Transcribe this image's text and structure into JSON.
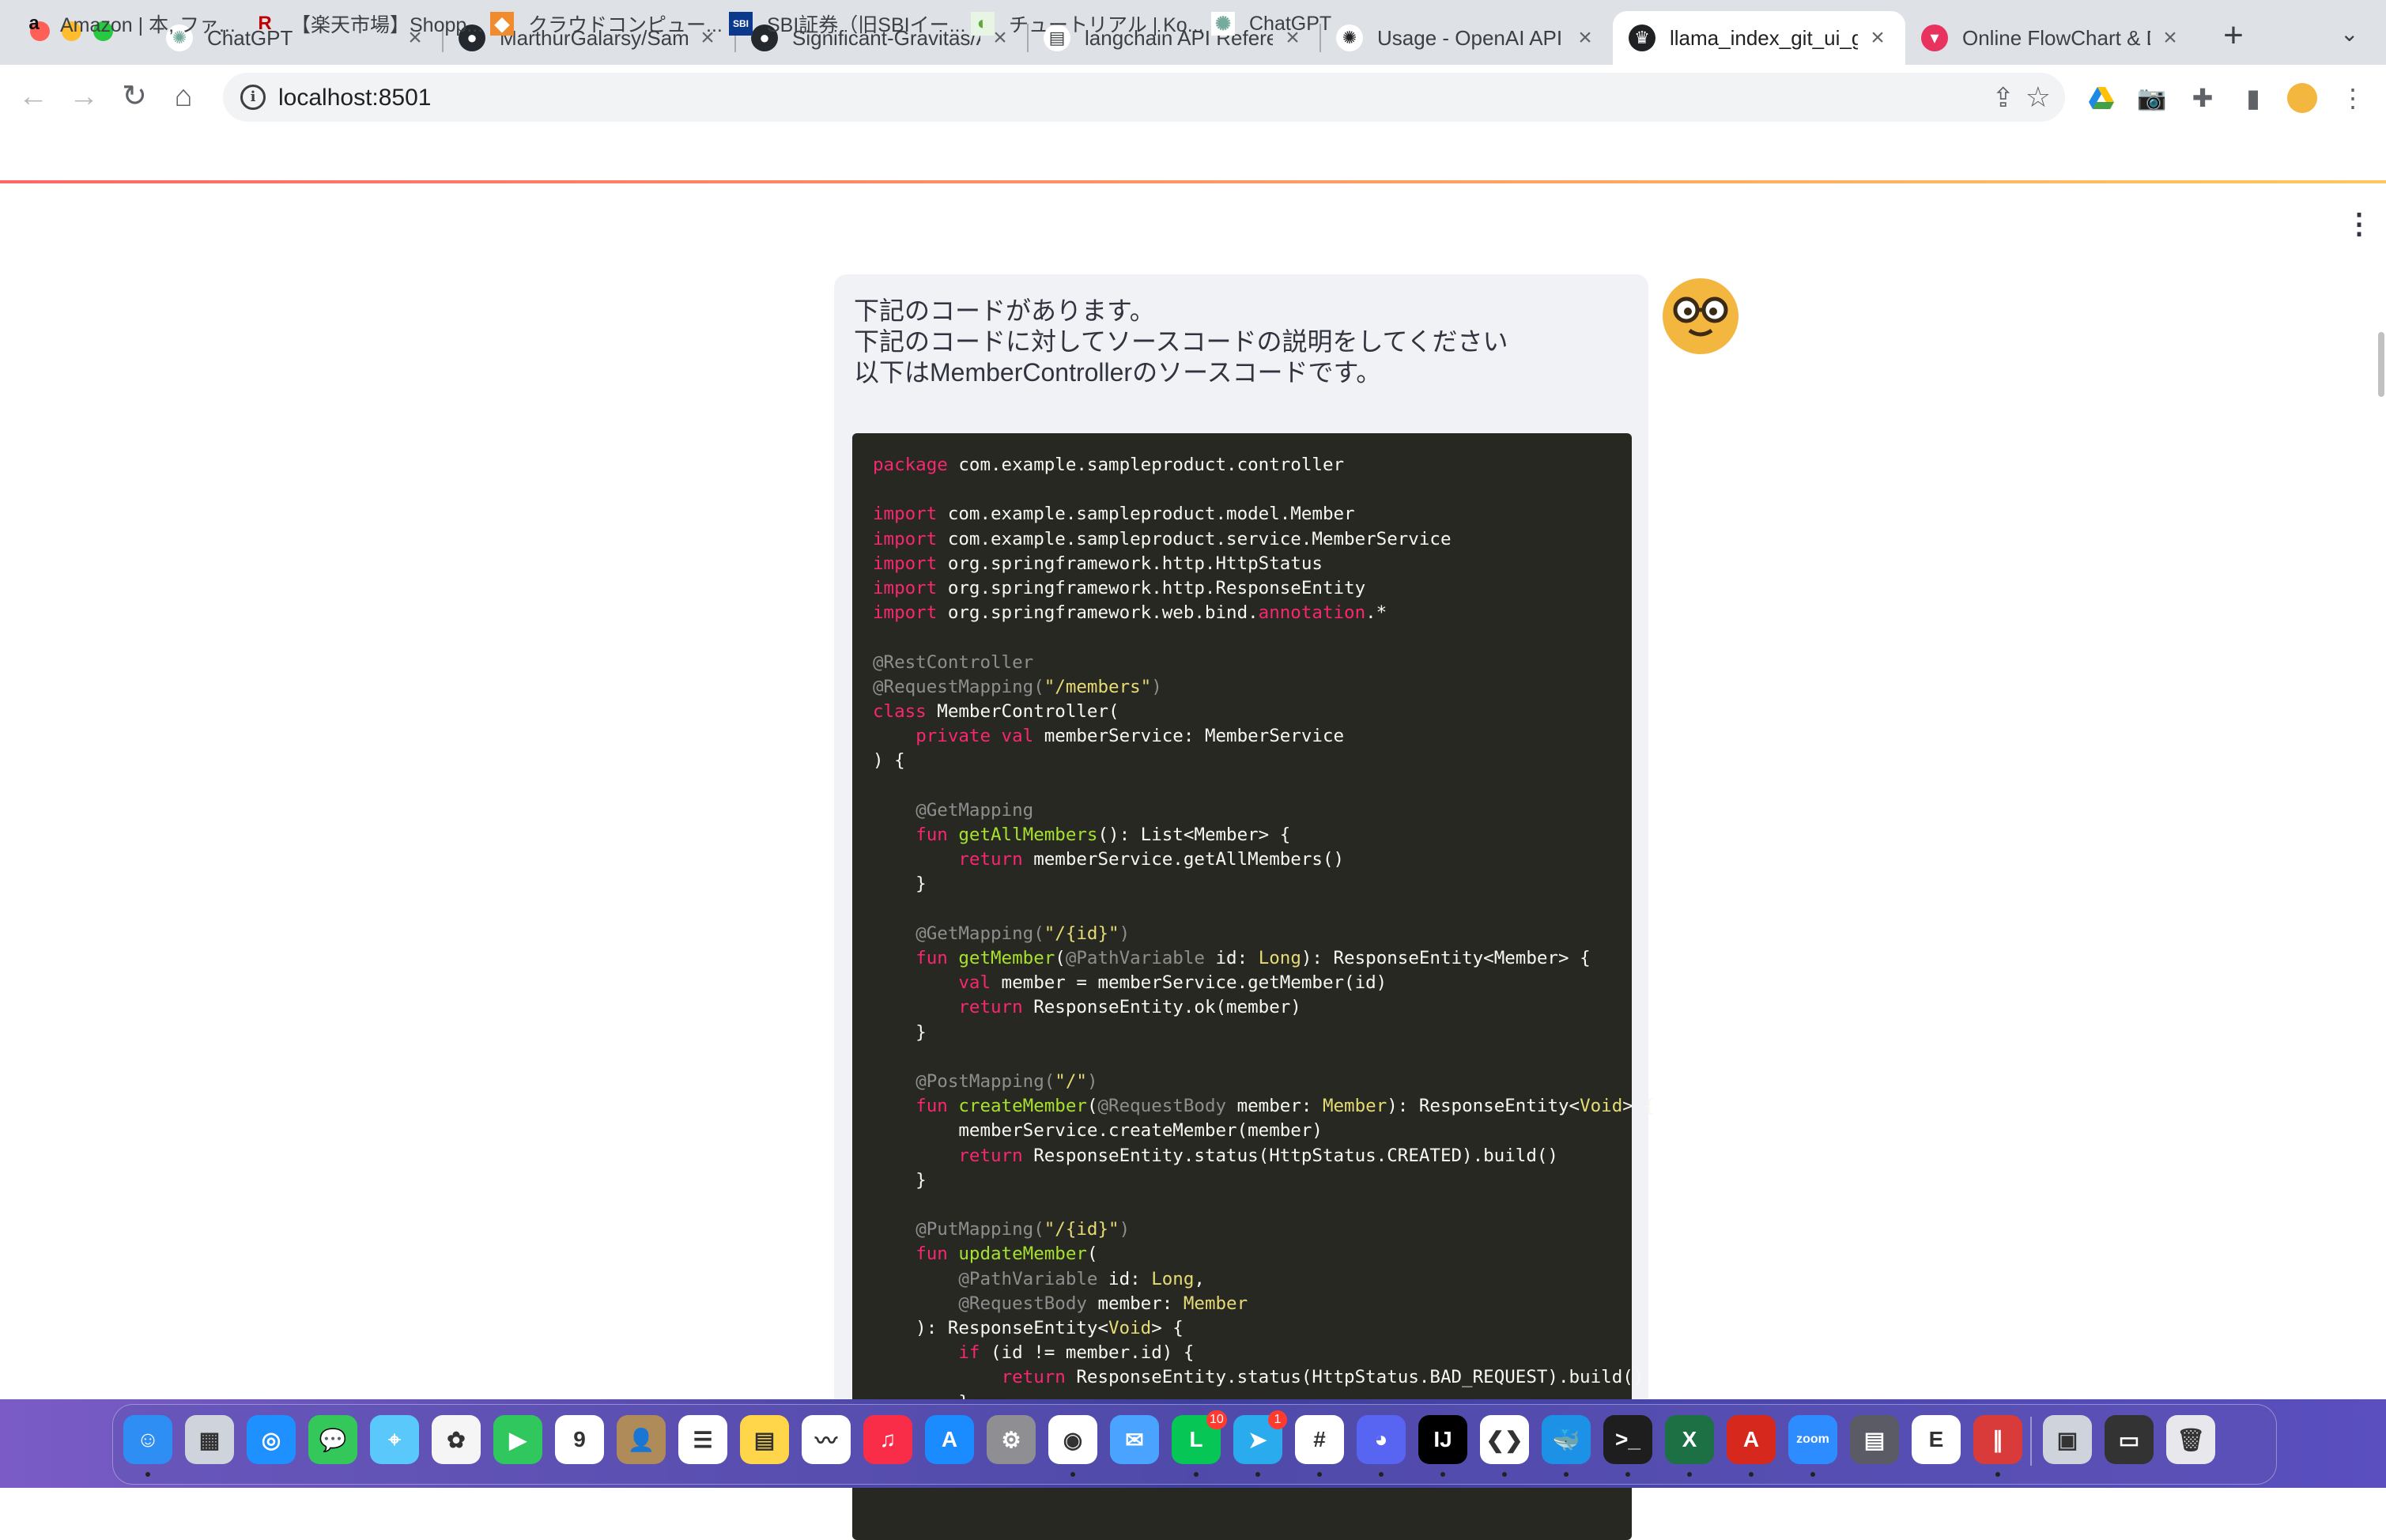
{
  "browser": {
    "tabs": [
      {
        "title": "ChatGPT",
        "icon": "chatgpt-icon",
        "active": false
      },
      {
        "title": "MarthurGalarsy/Samp",
        "icon": "github-icon",
        "active": false
      },
      {
        "title": "Significant-Gravitas/A",
        "icon": "github-icon",
        "active": false
      },
      {
        "title": "langchain API Referen",
        "icon": "document-icon",
        "active": false
      },
      {
        "title": "Usage - OpenAI API",
        "icon": "openai-icon",
        "active": false
      },
      {
        "title": "llama_index_git_ui_g",
        "icon": "streamlit-icon",
        "active": true
      },
      {
        "title": "Online FlowChart & D",
        "icon": "flowchart-icon",
        "active": false
      }
    ],
    "new_tab": "+",
    "tab_close": "×",
    "url": "localhost:8501",
    "bookmarks": [
      {
        "label": "Amazon | 本, ファ...",
        "icon": "amazon-icon"
      },
      {
        "label": "【楽天市場】Shopp...",
        "icon": "rakuten-icon"
      },
      {
        "label": "クラウドコンピュー...",
        "icon": "aws-icon"
      },
      {
        "label": "SBI証券（旧SBIイー...",
        "icon": "sbi-icon"
      },
      {
        "label": "チュートリアル | Ko...",
        "icon": "kotlin-icon"
      },
      {
        "label": "ChatGPT",
        "icon": "chatgpt-icon"
      }
    ]
  },
  "chat": {
    "message_lines": [
      "下記のコードがあります。",
      "下記のコードに対してソースコードの説明をしてください",
      "以下はMemberControllerのソースコードです。"
    ],
    "code_lines": [
      [
        {
          "c": "k",
          "t": "package"
        },
        {
          "c": "",
          "t": " com.example.sampleproduct.controller"
        }
      ],
      [],
      [
        {
          "c": "k",
          "t": "import"
        },
        {
          "c": "",
          "t": " com.example.sampleproduct.model.Member"
        }
      ],
      [
        {
          "c": "k",
          "t": "import"
        },
        {
          "c": "",
          "t": " com.example.sampleproduct.service.MemberService"
        }
      ],
      [
        {
          "c": "k",
          "t": "import"
        },
        {
          "c": "",
          "t": " org.springframework.http.HttpStatus"
        }
      ],
      [
        {
          "c": "k",
          "t": "import"
        },
        {
          "c": "",
          "t": " org.springframework.http.ResponseEntity"
        }
      ],
      [
        {
          "c": "k",
          "t": "import"
        },
        {
          "c": "",
          "t": " org.springframework.web.bind."
        },
        {
          "c": "k",
          "t": "annotation"
        },
        {
          "c": "",
          "t": ".*"
        }
      ],
      [],
      [
        {
          "c": "a",
          "t": "@RestController"
        }
      ],
      [
        {
          "c": "a",
          "t": "@RequestMapping("
        },
        {
          "c": "s",
          "t": "\"/members\""
        },
        {
          "c": "a",
          "t": ")"
        }
      ],
      [
        {
          "c": "k",
          "t": "class"
        },
        {
          "c": "",
          "t": " MemberController("
        }
      ],
      [
        {
          "c": "",
          "t": "    "
        },
        {
          "c": "k",
          "t": "private val"
        },
        {
          "c": "",
          "t": " memberService: MemberService"
        }
      ],
      [
        {
          "c": "",
          "t": ") {"
        }
      ],
      [],
      [
        {
          "c": "",
          "t": "    "
        },
        {
          "c": "a",
          "t": "@GetMapping"
        }
      ],
      [
        {
          "c": "",
          "t": "    "
        },
        {
          "c": "k",
          "t": "fun"
        },
        {
          "c": "",
          "t": " "
        },
        {
          "c": "f",
          "t": "getAllMembers"
        },
        {
          "c": "",
          "t": "(): List<Member> {"
        }
      ],
      [
        {
          "c": "",
          "t": "        "
        },
        {
          "c": "k",
          "t": "return"
        },
        {
          "c": "",
          "t": " memberService.getAllMembers()"
        }
      ],
      [
        {
          "c": "",
          "t": "    }"
        }
      ],
      [],
      [
        {
          "c": "",
          "t": "    "
        },
        {
          "c": "a",
          "t": "@GetMapping("
        },
        {
          "c": "s",
          "t": "\"/{id}\""
        },
        {
          "c": "a",
          "t": ")"
        }
      ],
      [
        {
          "c": "",
          "t": "    "
        },
        {
          "c": "k",
          "t": "fun"
        },
        {
          "c": "",
          "t": " "
        },
        {
          "c": "f",
          "t": "getMember"
        },
        {
          "c": "",
          "t": "("
        },
        {
          "c": "a",
          "t": "@PathVariable"
        },
        {
          "c": "",
          "t": " id: "
        },
        {
          "c": "t",
          "t": "Long"
        },
        {
          "c": "",
          "t": "): ResponseEntity<Member> {"
        }
      ],
      [
        {
          "c": "",
          "t": "        "
        },
        {
          "c": "k",
          "t": "val"
        },
        {
          "c": "",
          "t": " member = memberService.getMember(id)"
        }
      ],
      [
        {
          "c": "",
          "t": "        "
        },
        {
          "c": "k",
          "t": "return"
        },
        {
          "c": "",
          "t": " ResponseEntity.ok(member)"
        }
      ],
      [
        {
          "c": "",
          "t": "    }"
        }
      ],
      [],
      [
        {
          "c": "",
          "t": "    "
        },
        {
          "c": "a",
          "t": "@PostMapping("
        },
        {
          "c": "s",
          "t": "\"/\""
        },
        {
          "c": "a",
          "t": ")"
        }
      ],
      [
        {
          "c": "",
          "t": "    "
        },
        {
          "c": "k",
          "t": "fun"
        },
        {
          "c": "",
          "t": " "
        },
        {
          "c": "f",
          "t": "createMember"
        },
        {
          "c": "",
          "t": "("
        },
        {
          "c": "a",
          "t": "@RequestBody"
        },
        {
          "c": "",
          "t": " member: "
        },
        {
          "c": "t",
          "t": "Member"
        },
        {
          "c": "",
          "t": "): ResponseEntity<"
        },
        {
          "c": "t",
          "t": "Void"
        },
        {
          "c": "",
          "t": "> {"
        }
      ],
      [
        {
          "c": "",
          "t": "        memberService.createMember(member)"
        }
      ],
      [
        {
          "c": "",
          "t": "        "
        },
        {
          "c": "k",
          "t": "return"
        },
        {
          "c": "",
          "t": " ResponseEntity.status(HttpStatus.CREATED).build()"
        }
      ],
      [
        {
          "c": "",
          "t": "    }"
        }
      ],
      [],
      [
        {
          "c": "",
          "t": "    "
        },
        {
          "c": "a",
          "t": "@PutMapping("
        },
        {
          "c": "s",
          "t": "\"/{id}\""
        },
        {
          "c": "a",
          "t": ")"
        }
      ],
      [
        {
          "c": "",
          "t": "    "
        },
        {
          "c": "k",
          "t": "fun"
        },
        {
          "c": "",
          "t": " "
        },
        {
          "c": "f",
          "t": "updateMember"
        },
        {
          "c": "",
          "t": "("
        }
      ],
      [
        {
          "c": "",
          "t": "        "
        },
        {
          "c": "a",
          "t": "@PathVariable"
        },
        {
          "c": "",
          "t": " id: "
        },
        {
          "c": "t",
          "t": "Long"
        },
        {
          "c": "",
          "t": ","
        }
      ],
      [
        {
          "c": "",
          "t": "        "
        },
        {
          "c": "a",
          "t": "@RequestBody"
        },
        {
          "c": "",
          "t": " member: "
        },
        {
          "c": "t",
          "t": "Member"
        }
      ],
      [
        {
          "c": "",
          "t": "    ): ResponseEntity<"
        },
        {
          "c": "t",
          "t": "Void"
        },
        {
          "c": "",
          "t": "> {"
        }
      ],
      [
        {
          "c": "",
          "t": "        "
        },
        {
          "c": "k",
          "t": "if"
        },
        {
          "c": "",
          "t": " (id != member.id) {"
        }
      ],
      [
        {
          "c": "",
          "t": "            "
        },
        {
          "c": "k",
          "t": "return"
        },
        {
          "c": "",
          "t": " ResponseEntity.status(HttpStatus.BAD_REQUEST).build()"
        }
      ],
      [
        {
          "c": "",
          "t": "        }"
        }
      ]
    ]
  },
  "dock": {
    "apps": [
      {
        "name": "finder-icon",
        "color": "#2e8ef4",
        "glyph": "☺"
      },
      {
        "name": "launchpad-icon",
        "color": "#cfd4dc",
        "glyph": "▦"
      },
      {
        "name": "safari-icon",
        "color": "#1e90ff",
        "glyph": "◎"
      },
      {
        "name": "messages-icon",
        "color": "#34c759",
        "glyph": "💬"
      },
      {
        "name": "maps-icon",
        "color": "#5ac8fa",
        "glyph": "⌖"
      },
      {
        "name": "photos-icon",
        "color": "#f5f5f5",
        "glyph": "✿"
      },
      {
        "name": "facetime-icon",
        "color": "#30c85e",
        "glyph": "▶"
      },
      {
        "name": "calendar-icon",
        "color": "#ffffff",
        "glyph": "9"
      },
      {
        "name": "contacts-icon",
        "color": "#b08b5a",
        "glyph": "👤"
      },
      {
        "name": "reminders-icon",
        "color": "#ffffff",
        "glyph": "☰"
      },
      {
        "name": "notes-icon",
        "color": "#ffd54a",
        "glyph": "▤"
      },
      {
        "name": "freeform-icon",
        "color": "#ffffff",
        "glyph": "〰"
      },
      {
        "name": "music-icon",
        "color": "#fa2d48",
        "glyph": "♫"
      },
      {
        "name": "app-store-icon",
        "color": "#1a8cff",
        "glyph": "A"
      },
      {
        "name": "system-settings-icon",
        "color": "#8e8e93",
        "glyph": "⚙"
      },
      {
        "name": "chrome-icon",
        "color": "#ffffff",
        "glyph": "◉"
      },
      {
        "name": "mail-icon",
        "color": "#4aa3ff",
        "glyph": "✉"
      },
      {
        "name": "line-icon",
        "color": "#06c755",
        "glyph": "L",
        "badge": "10"
      },
      {
        "name": "telegram-icon",
        "color": "#2aabee",
        "glyph": "➤",
        "badge": "1"
      },
      {
        "name": "slack-icon",
        "color": "#ffffff",
        "glyph": "#"
      },
      {
        "name": "discord-icon",
        "color": "#5865f2",
        "glyph": "◕"
      },
      {
        "name": "intellij-icon",
        "color": "#000000",
        "glyph": "IJ"
      },
      {
        "name": "vscode-icon",
        "color": "#ffffff",
        "glyph": "❮❯"
      },
      {
        "name": "docker-icon",
        "color": "#1d91e6",
        "glyph": "🐳"
      },
      {
        "name": "terminal-icon",
        "color": "#1e1e1e",
        "glyph": ">_"
      },
      {
        "name": "excel-icon",
        "color": "#1d7044",
        "glyph": "X"
      },
      {
        "name": "acrobat-icon",
        "color": "#d7281e",
        "glyph": "A"
      },
      {
        "name": "zoom-icon",
        "color": "#2d8cff",
        "glyph": "zoom"
      },
      {
        "name": "scanner-icon",
        "color": "#5b5b66",
        "glyph": "▤"
      },
      {
        "name": "textedit-icon",
        "color": "#ffffff",
        "glyph": "E"
      },
      {
        "name": "parallels-icon",
        "color": "#d93b3b",
        "glyph": "∥"
      },
      {
        "name": "preview-icon",
        "color": "#cfd4dc",
        "glyph": "▣"
      },
      {
        "name": "screen-capture-icon",
        "color": "#333333",
        "glyph": "▭"
      },
      {
        "name": "trash-icon",
        "color": "#e8e8ec",
        "glyph": "🗑"
      }
    ]
  }
}
